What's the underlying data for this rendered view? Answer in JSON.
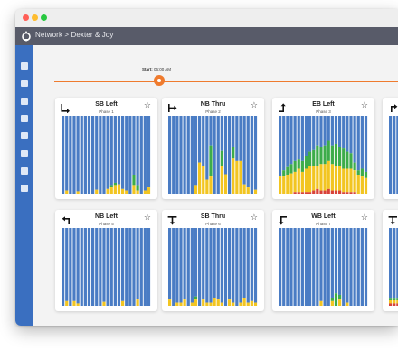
{
  "window": {
    "breadcrumb": "Network > Dexter & Joy",
    "sidebar_icons": [
      "nav-icon-1",
      "nav-icon-2",
      "nav-icon-3",
      "nav-icon-4",
      "nav-icon-5",
      "nav-icon-6",
      "nav-icon-7",
      "nav-icon-8"
    ]
  },
  "timeline": {
    "label_bold": "Start:",
    "label_time": " 06:00 AM",
    "accent_color": "#ef7b2e"
  },
  "colors": {
    "blue": "#4a7cc4",
    "yellow": "#f2c521",
    "green": "#3dac4a",
    "red": "#d8423a",
    "sidebar": "#3a6fc0",
    "appbar": "#585b69"
  },
  "cards": [
    {
      "name": "SB Left",
      "phase": "Phase 1",
      "arrow": "turn-right-icon",
      "bars": [
        [
          0,
          0,
          0
        ],
        [
          4,
          0,
          0
        ],
        [
          0,
          0,
          0
        ],
        [
          0,
          0,
          0
        ],
        [
          3,
          0,
          0
        ],
        [
          0,
          0,
          0
        ],
        [
          0,
          0,
          0
        ],
        [
          0,
          0,
          0
        ],
        [
          0,
          0,
          0
        ],
        [
          5,
          0,
          0
        ],
        [
          0,
          0,
          0
        ],
        [
          0,
          0,
          0
        ],
        [
          6,
          0,
          0
        ],
        [
          8,
          2,
          0
        ],
        [
          10,
          4,
          0
        ],
        [
          12,
          0,
          0
        ],
        [
          6,
          0,
          0
        ],
        [
          4,
          0,
          0
        ],
        [
          0,
          0,
          0
        ],
        [
          10,
          14,
          0
        ],
        [
          4,
          6,
          0
        ],
        [
          0,
          0,
          0
        ],
        [
          4,
          0,
          0
        ],
        [
          8,
          0,
          0
        ]
      ]
    },
    {
      "name": "NB Thru",
      "phase": "Phase 2",
      "arrow": "straight-right-icon",
      "bars": [
        [
          0,
          0,
          0
        ],
        [
          0,
          0,
          0
        ],
        [
          0,
          0,
          0
        ],
        [
          0,
          0,
          0
        ],
        [
          0,
          0,
          0
        ],
        [
          0,
          0,
          0
        ],
        [
          0,
          0,
          0
        ],
        [
          10,
          0,
          0
        ],
        [
          40,
          0,
          0
        ],
        [
          35,
          0,
          0
        ],
        [
          18,
          0,
          0
        ],
        [
          22,
          40,
          0
        ],
        [
          0,
          0,
          0
        ],
        [
          0,
          0,
          0
        ],
        [
          35,
          20,
          0
        ],
        [
          25,
          0,
          0
        ],
        [
          0,
          0,
          0
        ],
        [
          45,
          15,
          0
        ],
        [
          42,
          0,
          0
        ],
        [
          42,
          0,
          0
        ],
        [
          12,
          0,
          0
        ],
        [
          8,
          0,
          0
        ],
        [
          0,
          0,
          0
        ],
        [
          5,
          0,
          0
        ]
      ]
    },
    {
      "name": "EB Left",
      "phase": "Phase 3",
      "arrow": "turn-up-icon",
      "bars": [
        [
          22,
          0,
          0
        ],
        [
          22,
          8,
          0
        ],
        [
          24,
          10,
          0
        ],
        [
          26,
          12,
          0
        ],
        [
          26,
          14,
          2
        ],
        [
          30,
          12,
          2
        ],
        [
          26,
          14,
          2
        ],
        [
          30,
          16,
          2
        ],
        [
          34,
          18,
          2
        ],
        [
          32,
          20,
          4
        ],
        [
          30,
          26,
          6
        ],
        [
          34,
          22,
          4
        ],
        [
          34,
          24,
          4
        ],
        [
          36,
          26,
          6
        ],
        [
          34,
          24,
          4
        ],
        [
          32,
          28,
          4
        ],
        [
          32,
          24,
          4
        ],
        [
          30,
          26,
          2
        ],
        [
          30,
          22,
          2
        ],
        [
          30,
          20,
          2
        ],
        [
          28,
          10,
          2
        ],
        [
          24,
          6,
          0
        ],
        [
          22,
          10,
          0
        ],
        [
          20,
          8,
          0
        ]
      ]
    },
    {
      "name": "NB Left",
      "phase": "Phase 5",
      "arrow": "turn-left-icon",
      "bars": [
        [
          0,
          0,
          0
        ],
        [
          6,
          0,
          0
        ],
        [
          0,
          0,
          0
        ],
        [
          6,
          0,
          0
        ],
        [
          3,
          0,
          0
        ],
        [
          0,
          0,
          0
        ],
        [
          0,
          0,
          0
        ],
        [
          0,
          0,
          0
        ],
        [
          0,
          0,
          0
        ],
        [
          0,
          0,
          0
        ],
        [
          0,
          0,
          0
        ],
        [
          5,
          0,
          0
        ],
        [
          0,
          0,
          0
        ],
        [
          0,
          0,
          0
        ],
        [
          0,
          0,
          0
        ],
        [
          0,
          0,
          0
        ],
        [
          6,
          0,
          0
        ],
        [
          0,
          0,
          0
        ],
        [
          0,
          0,
          0
        ],
        [
          0,
          0,
          0
        ],
        [
          8,
          0,
          0
        ],
        [
          0,
          0,
          0
        ],
        [
          0,
          0,
          0
        ],
        [
          0,
          0,
          0
        ]
      ]
    },
    {
      "name": "SB Thru",
      "phase": "Phase 6",
      "arrow": "straight-down-icon",
      "bars": [
        [
          8,
          0,
          0
        ],
        [
          0,
          0,
          0
        ],
        [
          4,
          0,
          0
        ],
        [
          4,
          0,
          0
        ],
        [
          8,
          0,
          0
        ],
        [
          0,
          0,
          0
        ],
        [
          4,
          0,
          0
        ],
        [
          8,
          4,
          0
        ],
        [
          0,
          0,
          0
        ],
        [
          8,
          0,
          0
        ],
        [
          4,
          0,
          0
        ],
        [
          4,
          0,
          0
        ],
        [
          10,
          0,
          0
        ],
        [
          8,
          0,
          0
        ],
        [
          4,
          0,
          0
        ],
        [
          0,
          0,
          0
        ],
        [
          8,
          0,
          0
        ],
        [
          4,
          0,
          0
        ],
        [
          0,
          0,
          0
        ],
        [
          4,
          0,
          0
        ],
        [
          10,
          0,
          0
        ],
        [
          4,
          0,
          0
        ],
        [
          6,
          0,
          0
        ],
        [
          4,
          0,
          0
        ]
      ]
    },
    {
      "name": "WB Left",
      "phase": "Phase 7",
      "arrow": "turn-down-icon",
      "bars": [
        [
          0,
          0,
          0
        ],
        [
          0,
          0,
          0
        ],
        [
          0,
          0,
          0
        ],
        [
          0,
          0,
          0
        ],
        [
          0,
          0,
          0
        ],
        [
          0,
          0,
          0
        ],
        [
          0,
          0,
          0
        ],
        [
          0,
          0,
          0
        ],
        [
          0,
          0,
          0
        ],
        [
          0,
          0,
          0
        ],
        [
          0,
          0,
          0
        ],
        [
          6,
          0,
          0
        ],
        [
          0,
          0,
          0
        ],
        [
          0,
          0,
          0
        ],
        [
          6,
          4,
          0
        ],
        [
          0,
          16,
          0
        ],
        [
          8,
          6,
          0
        ],
        [
          0,
          0,
          0
        ],
        [
          4,
          0,
          0
        ],
        [
          0,
          0,
          0
        ],
        [
          0,
          0,
          0
        ],
        [
          0,
          0,
          0
        ],
        [
          0,
          0,
          0
        ],
        [
          0,
          0,
          0
        ]
      ]
    }
  ],
  "partial_cards": [
    {
      "arrow": "turn-icon-partial-top"
    },
    {
      "arrow": "turn-icon-partial-bottom"
    }
  ]
}
